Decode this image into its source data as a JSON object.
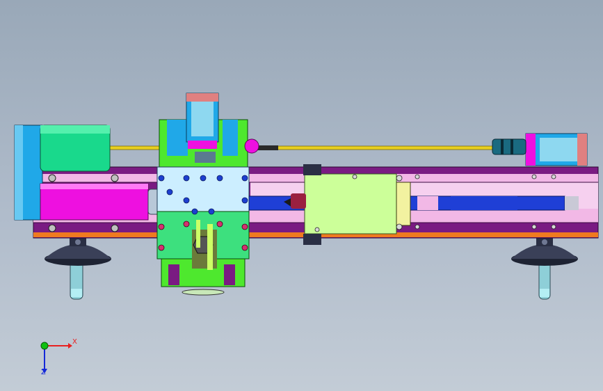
{
  "axes": {
    "x_label": "X",
    "z_label": "Z",
    "x_color": "#e82020",
    "y_color": "#10c010",
    "z_color": "#1428d8"
  },
  "palette": {
    "bed_purple": "#7a1b82",
    "bed_pink": "#f2b8e6",
    "rail_orange": "#ef7a20",
    "motor_green": "#19d98c",
    "motor_cyan": "#20a8e8",
    "magenta": "#ee10e0",
    "carriage_light": "#cceeff",
    "carriage_green": "#3de07e",
    "carriage_lime": "#4ee82e",
    "tailstock": "#ccff99",
    "slot_blue": "#1f3fd6",
    "leadscrew": "#e8d020",
    "handwheel": "#2a2f44"
  }
}
